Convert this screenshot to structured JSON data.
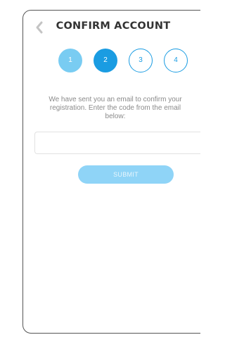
{
  "header": {
    "title": "CONFIRM ACCOUNT",
    "back_icon": "chevron-left-icon"
  },
  "steps": [
    {
      "label": "1",
      "state": "completed"
    },
    {
      "label": "2",
      "state": "current"
    },
    {
      "label": "3",
      "state": "upcoming"
    },
    {
      "label": "4",
      "state": "upcoming"
    }
  ],
  "message": {
    "line1": "We have sent you an email to confirm your",
    "line2": "registration. Enter the code from the email",
    "line3": "below:"
  },
  "form": {
    "code_value": "",
    "code_placeholder": "",
    "submit_label": "SUBMIT"
  },
  "colors": {
    "step_completed": "#79ccf2",
    "step_current": "#1a9ce2",
    "step_outline": "#1a9ce2",
    "submit_background": "#8fd4f7",
    "text_muted": "#8a8a8a",
    "title_text": "#333333"
  }
}
